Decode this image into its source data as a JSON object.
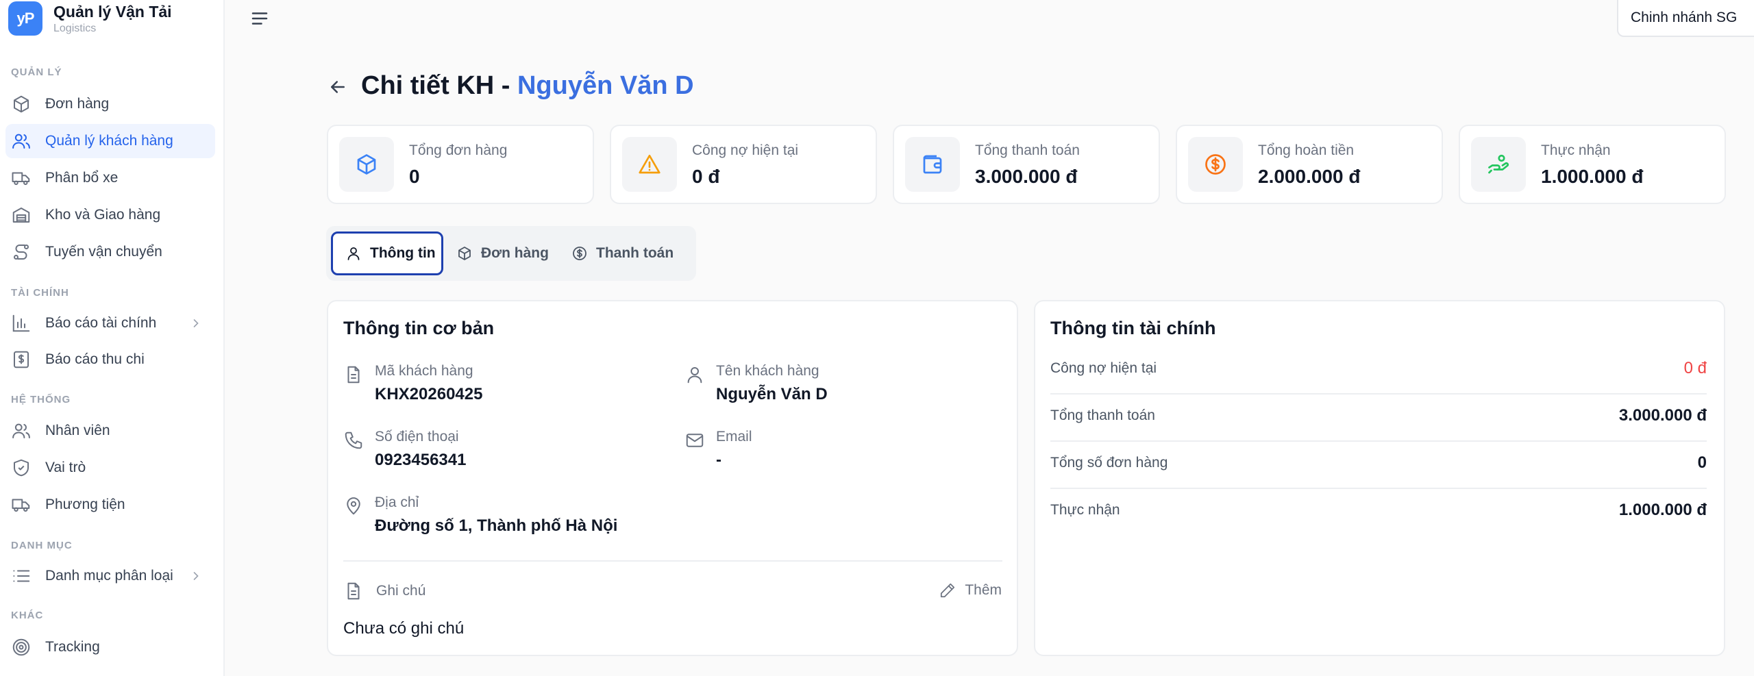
{
  "brand": {
    "logo": "yP",
    "title": "Quản lý Vận Tải",
    "subtitle": "Logistics"
  },
  "sidebar": {
    "sections": [
      "QUẢN LÝ",
      "TÀI CHÍNH",
      "HỆ THỐNG",
      "DANH MỤC",
      "KHÁC"
    ],
    "items": [
      {
        "label": "Đơn hàng",
        "icon": "package-icon"
      },
      {
        "label": "Quản lý khách hàng",
        "icon": "users-icon",
        "active": true
      },
      {
        "label": "Phân bổ xe",
        "icon": "truck-icon"
      },
      {
        "label": "Kho và Giao hàng",
        "icon": "warehouse-icon"
      },
      {
        "label": "Tuyến vận chuyển",
        "icon": "route-icon"
      },
      {
        "label": "Báo cáo tài chính",
        "icon": "bar-chart-icon"
      },
      {
        "label": "Báo cáo thu chi",
        "icon": "receipt-icon"
      },
      {
        "label": "Nhân viên",
        "icon": "users-icon"
      },
      {
        "label": "Vai trò",
        "icon": "shield-icon"
      },
      {
        "label": "Phương tiện",
        "icon": "truck-icon"
      },
      {
        "label": "Danh mục phân loại",
        "icon": "list-icon"
      },
      {
        "label": "Tracking",
        "icon": "target-icon"
      }
    ]
  },
  "topbar": {
    "branch": "Chinh nhánh SG"
  },
  "header": {
    "title_prefix": "Chi tiết KH - ",
    "customer_name": "Nguyễn Văn D"
  },
  "stats": [
    {
      "label": "Tổng đơn hàng",
      "value": "0",
      "icon": "box-icon",
      "color": "#3b82f6"
    },
    {
      "label": "Công nợ hiện tại",
      "value": "0 đ",
      "icon": "warning-icon",
      "color": "#f59e0b"
    },
    {
      "label": "Tổng thanh toán",
      "value": "3.000.000 đ",
      "icon": "wallet-icon",
      "color": "#3b82f6"
    },
    {
      "label": "Tổng hoàn tiền",
      "value": "2.000.000 đ",
      "icon": "dollar-circle-icon",
      "color": "#f97316"
    },
    {
      "label": "Thực nhận",
      "value": "1.000.000 đ",
      "icon": "hand-coins-icon",
      "color": "#22c55e"
    }
  ],
  "tabs": [
    {
      "label": "Thông tin",
      "active": true
    },
    {
      "label": "Đơn hàng"
    },
    {
      "label": "Thanh toán"
    }
  ],
  "basic_info": {
    "title": "Thông tin cơ bản",
    "customer_code": {
      "label": "Mã khách hàng",
      "value": "KHX20260425"
    },
    "customer_name": {
      "label": "Tên khách hàng",
      "value": "Nguyễn Văn D"
    },
    "phone": {
      "label": "Số điện thoại",
      "value": "0923456341"
    },
    "email": {
      "label": "Email",
      "value": "-"
    },
    "address": {
      "label": "Địa chỉ",
      "value": "Đường số 1, Thành phố Hà Nội"
    },
    "note": {
      "label": "Ghi chú",
      "add_label": "Thêm",
      "value": "Chưa có ghi chú"
    }
  },
  "finance": {
    "title": "Thông tin tài chính",
    "rows": [
      {
        "label": "Công nợ hiện tại",
        "value": "0 đ"
      },
      {
        "label": "Tổng thanh toán",
        "value": "3.000.000 đ"
      },
      {
        "label": "Tổng số đơn hàng",
        "value": "0"
      },
      {
        "label": "Thực nhận",
        "value": "1.000.000 đ"
      }
    ]
  }
}
